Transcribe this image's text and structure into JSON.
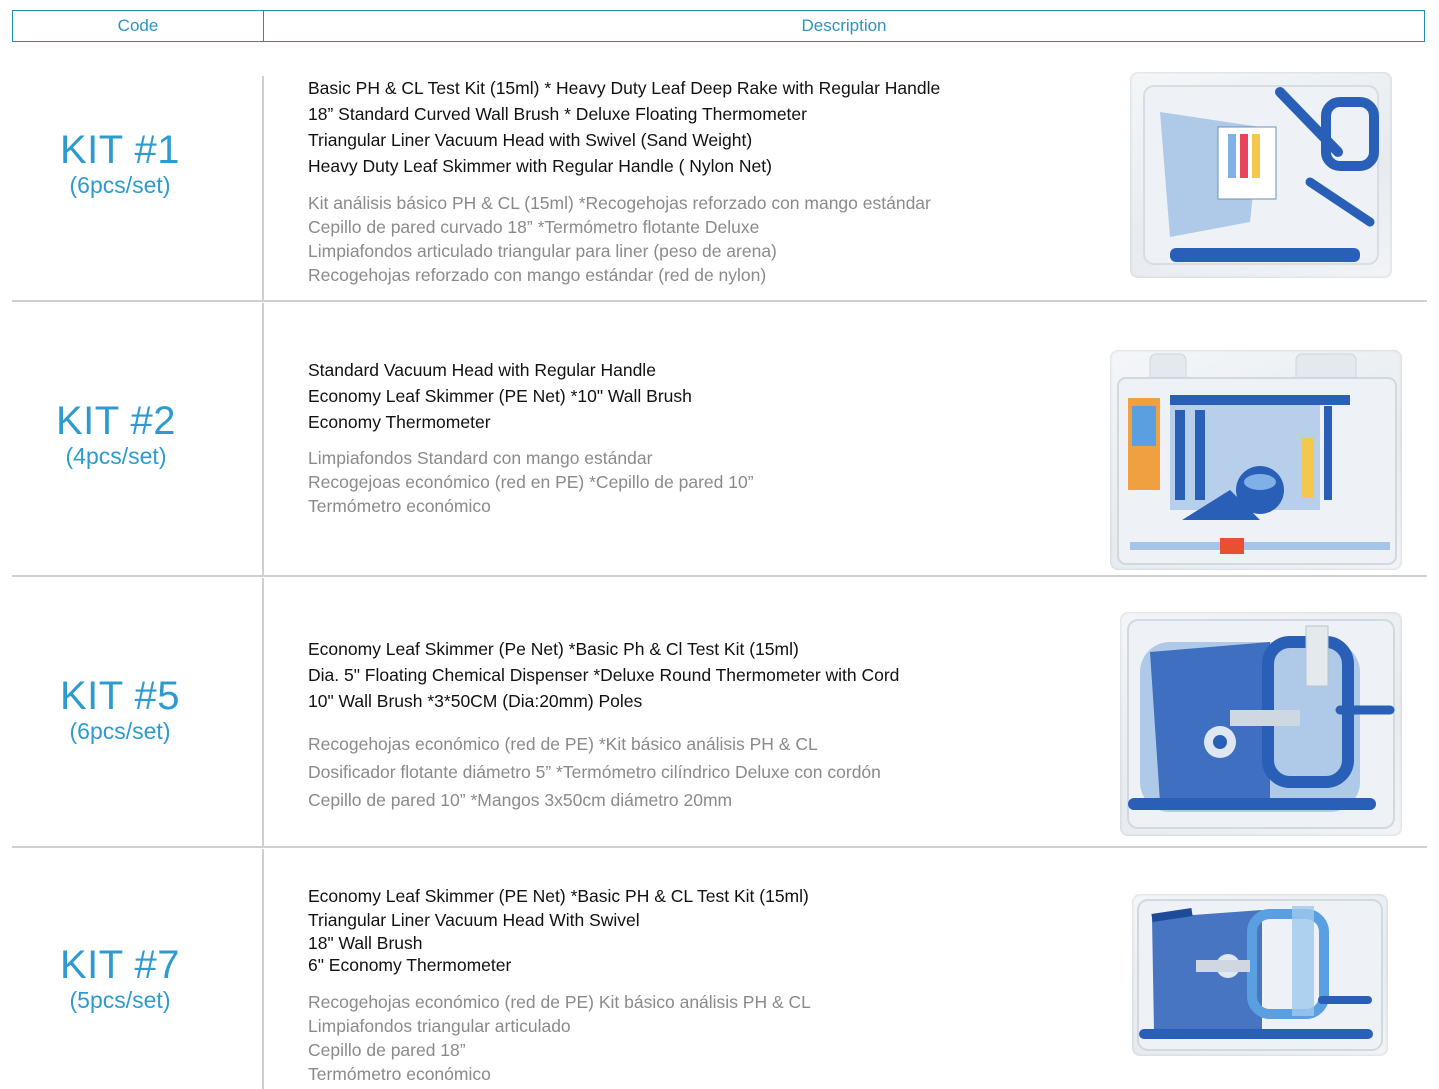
{
  "header": {
    "code": "Code",
    "description": "Description"
  },
  "kits": [
    {
      "name": "KIT #1",
      "pcs": "(6pcs/set)",
      "en": [
        "Basic PH & CL Test Kit (15ml) * Heavy Duty Leaf Deep Rake with Regular Handle",
        "18” Standard Curved Wall Brush * Deluxe Floating Thermometer",
        "Triangular Liner Vacuum Head with Swivel (Sand Weight)",
        "Heavy Duty Leaf Skimmer with Regular Handle ( Nylon Net)"
      ],
      "es": [
        "Kit análisis básico PH & CL (15ml)     *Recogehojas reforzado con mango estándar",
        "Cepillo de pared curvado 18”  *Termómetro flotante Deluxe",
        "Limpiafondos articulado triangular para liner (peso de arena)",
        "Recogehojas reforzado con mango estándar (red de nylon)"
      ]
    },
    {
      "name": "KIT #2",
      "pcs": "(4pcs/set)",
      "en": [
        "Standard Vacuum Head with Regular Handle",
        "Economy Leaf Skimmer (PE Net) *10\" Wall Brush",
        "Economy Thermometer"
      ],
      "es": [
        "Limpiafondos Standard con mango estándar",
        "Recogejoas económico (red en PE)  *Cepillo de pared 10”",
        "Termómetro económico"
      ]
    },
    {
      "name": "KIT #5",
      "pcs": "(6pcs/set)",
      "en": [
        "Economy Leaf Skimmer (Pe Net) *Basic Ph & Cl Test Kit (15ml)",
        "Dia. 5\" Floating Chemical Dispenser *Deluxe Round Thermometer with Cord",
        "10\" Wall Brush    *3*50CM (Dia:20mm) Poles"
      ],
      "es": [
        "Recogehojas económico (red de PE)  *Kit básico análisis PH & CL",
        "Dosificador flotante diámetro 5”   *Termómetro cilíndrico Deluxe con cordón",
        "Cepillo de pared 10”  *Mangos 3x50cm diámetro 20mm"
      ]
    },
    {
      "name": "KIT #7",
      "pcs": "(5pcs/set)",
      "en": [
        "Economy Leaf Skimmer (PE Net) *Basic PH & CL Test Kit (15ml)",
        "Triangular Liner Vacuum Head With Swivel",
        "18\" Wall Brush",
        " 6\" Economy Thermometer"
      ],
      "es": [
        "Recogehojas económico (red de PE)  Kit básico análisis PH & CL",
        "Limpiafondos triangular articulado",
        "Cepillo de pared 18”",
        "Termómetro económico"
      ]
    }
  ],
  "colors": {
    "accent": "#2d9bd0",
    "border": "#1e8fb0",
    "product_blue": "#2a5fb8"
  }
}
